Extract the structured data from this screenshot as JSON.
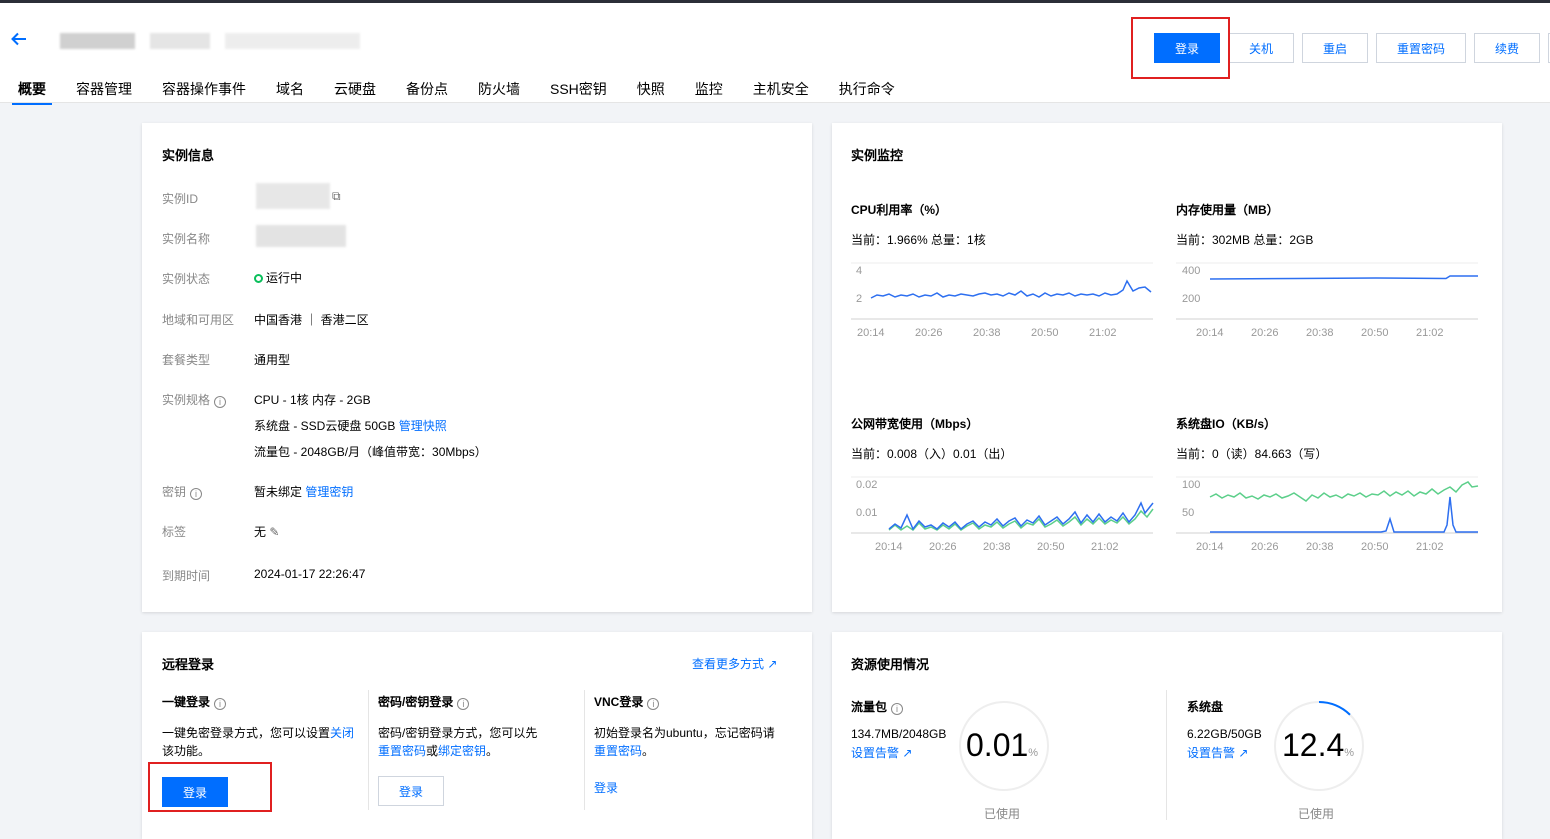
{
  "header": {
    "buttons": {
      "login": "登录",
      "shutdown": "关机",
      "restart": "重启",
      "reset_password": "重置密码",
      "renew": "续费"
    }
  },
  "tabs": [
    {
      "label": "概要",
      "active": true
    },
    {
      "label": "容器管理"
    },
    {
      "label": "容器操作事件"
    },
    {
      "label": "域名"
    },
    {
      "label": "云硬盘"
    },
    {
      "label": "备份点"
    },
    {
      "label": "防火墙"
    },
    {
      "label": "SSH密钥"
    },
    {
      "label": "快照"
    },
    {
      "label": "监控"
    },
    {
      "label": "主机安全"
    },
    {
      "label": "执行命令"
    }
  ],
  "instance": {
    "title": "实例信息",
    "labels": {
      "id": "实例ID",
      "name": "实例名称",
      "status": "实例状态",
      "region": "地域和可用区",
      "plan_type": "套餐类型",
      "spec": "实例规格",
      "key": "密钥",
      "tag": "标签",
      "expire": "到期时间"
    },
    "status": "运行中",
    "region": "中国香港 ｜ 香港二区",
    "plan_type": "通用型",
    "spec_line1": "CPU - 1核 内存 - 2GB",
    "spec_line2": "系统盘 - SSD云硬盘 50GB",
    "manage_snapshot": "管理快照",
    "spec_line3": "流量包 - 2048GB/月（峰值带宽：30Mbps）",
    "key_value": "暂未绑定",
    "manage_key": "管理密钥",
    "tag_value": "无",
    "expire": "2024-01-17 22:26:47"
  },
  "monitor": {
    "title": "实例监控",
    "cpu": {
      "title": "CPU利用率（%）",
      "current": "当前：1.966% 总量：1核",
      "y_ticks": [
        "4",
        "2"
      ],
      "x_ticks": [
        "20:14",
        "20:26",
        "20:38",
        "20:50",
        "21:02"
      ]
    },
    "mem": {
      "title": "内存使用量（MB）",
      "current": "当前：302MB 总量：2GB",
      "y_ticks": [
        "400",
        "200"
      ],
      "x_ticks": [
        "20:14",
        "20:26",
        "20:38",
        "20:50",
        "21:02"
      ]
    },
    "net": {
      "title": "公网带宽使用（Mbps）",
      "current": "当前：0.008（入）0.01（出）",
      "y_ticks": [
        "0.02",
        "0.01"
      ],
      "x_ticks": [
        "20:14",
        "20:26",
        "20:38",
        "20:50",
        "21:02"
      ]
    },
    "disk": {
      "title": "系统盘IO（KB/s）",
      "current": "当前：0（读）84.663（写）",
      "y_ticks": [
        "100",
        "50"
      ],
      "x_ticks": [
        "20:14",
        "20:26",
        "20:38",
        "20:50",
        "21:02"
      ]
    },
    "colors": {
      "blue": "#2d6ff0",
      "green": "#5ccf8a"
    }
  },
  "remote": {
    "title": "远程登录",
    "more": "查看更多方式",
    "one_click": {
      "title": "一键登录",
      "desc1": "一键免密登录方式，您可以设置",
      "close_link": "关闭",
      "desc2": "该功能。",
      "button": "登录"
    },
    "password": {
      "title": "密码/密钥登录",
      "desc1": "密码/密钥登录方式，您可以先",
      "reset_link": "重置密码",
      "or": "或",
      "bind_link": "绑定密钥",
      "period": "。",
      "button": "登录"
    },
    "vnc": {
      "title": "VNC登录",
      "desc1": "初始登录名为ubuntu，忘记密码请",
      "reset_link": "重置密码",
      "period": "。",
      "link": "登录"
    }
  },
  "resources": {
    "title": "资源使用情况",
    "traffic": {
      "title": "流量包",
      "usage": "134.7MB/2048GB",
      "alert": "设置告警",
      "percent": "0.01",
      "unit": "%",
      "used": "已使用",
      "fraction": 0.0001
    },
    "disk": {
      "title": "系统盘",
      "usage": "6.22GB/50GB",
      "alert": "设置告警",
      "percent": "12.4",
      "unit": "%",
      "used": "已使用",
      "fraction": 0.124
    }
  }
}
